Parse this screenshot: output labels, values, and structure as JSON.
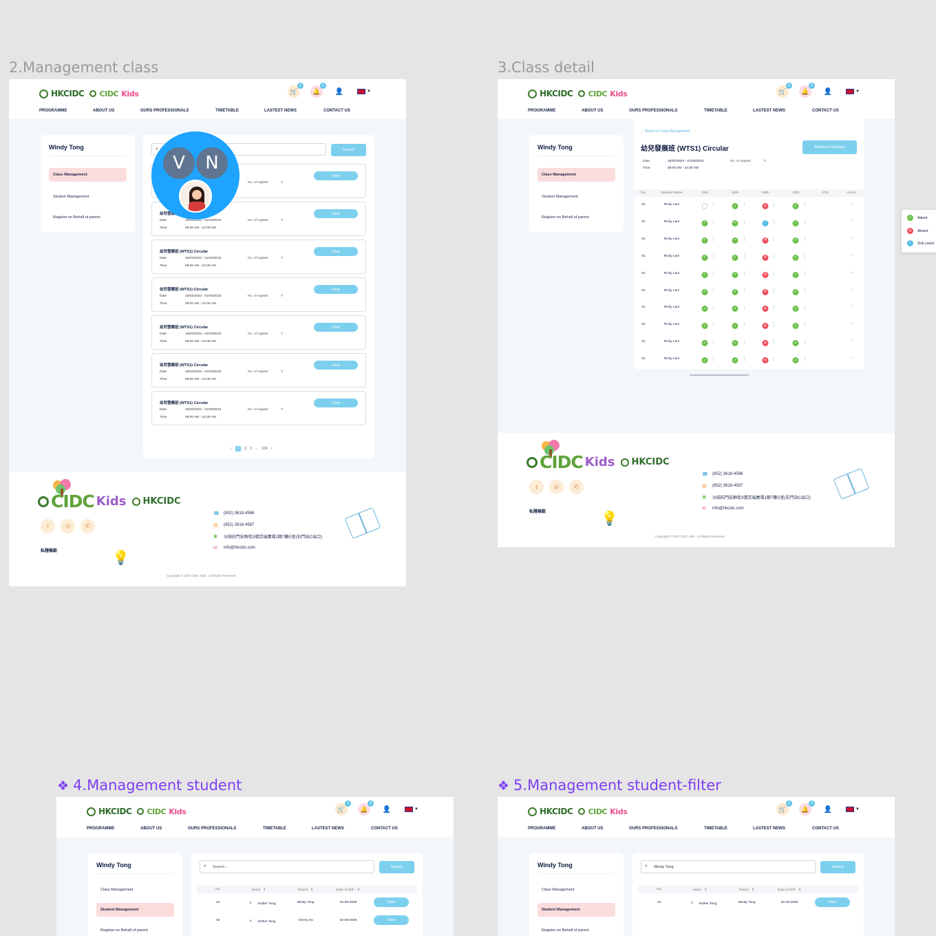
{
  "frames": {
    "f2": {
      "title": "2.Management class"
    },
    "f3": {
      "title": "3.Class detail"
    },
    "f4": {
      "title": "4.Management student"
    },
    "f5": {
      "title": "5.Management student-filter"
    }
  },
  "header": {
    "logo_hk": "HKCIDC",
    "logo_cidc": "CIDC",
    "logo_kids": "Kids",
    "cart_count": "0",
    "bell_count": "0",
    "nav": [
      "PROGRAMME",
      "ABOUT US",
      "OURS PROFESSIONALS",
      "TIMETABLE",
      "LASTEST NEWS",
      "CONTACT US"
    ]
  },
  "sidebar": {
    "user": "Windy Tong",
    "items": [
      "Class Management",
      "Student Management",
      "Register on Behalf of parent"
    ]
  },
  "class_list": {
    "search_button": "Search",
    "cards": [
      {
        "title": "幼兒發展班 (WTS1) Circular",
        "date_label": "Date",
        "date": "15/02/2023 - 01/03/2023",
        "time_label": "Time",
        "time": "08:00 AM - 10:30 AM",
        "reg_label": "No. of register",
        "reg": "7",
        "button": "View"
      }
    ],
    "pager": [
      "‹",
      "1",
      "2",
      "3",
      "...",
      "100",
      "›"
    ]
  },
  "avatars": {
    "v": "V",
    "n": "N"
  },
  "class_detail": {
    "back": "← Return to Class Management",
    "title": "幼兒發展班 (WTS1) Circular",
    "broadcast": "Broadcast Message",
    "date_label": "Date",
    "date": "15/02/2023 - 01/03/2023",
    "time_label": "Time",
    "time": "08:00 AM - 10:30 AM",
    "reg_label": "No. of register",
    "reg": "7",
    "columns": [
      "No.",
      "Student Name",
      "23/8",
      "30/8",
      "06/9",
      "13/9",
      "27/9",
      "Action"
    ],
    "row_no": "01",
    "row_name": "Ricky Lam",
    "row_action": "...",
    "rows": [
      [
        "empty",
        "ok",
        "no",
        "ok"
      ],
      [
        "ok",
        "ok",
        "sick",
        "ok"
      ],
      [
        "ok",
        "ok",
        "no",
        "ok"
      ],
      [
        "ok",
        "ok",
        "no",
        "ok"
      ],
      [
        "ok",
        "ok",
        "no",
        "ok"
      ],
      [
        "ok",
        "ok",
        "no",
        "ok"
      ],
      [
        "ok",
        "ok",
        "no",
        "ok"
      ],
      [
        "ok",
        "ok",
        "no",
        "ok"
      ],
      [
        "ok",
        "ok",
        "no",
        "ok"
      ],
      [
        "ok",
        "ok",
        "no",
        "ok"
      ]
    ]
  },
  "legend": [
    "Attend",
    "Absent",
    "Sick Leave"
  ],
  "student_mgmt": {
    "search_placeholder": "Search...",
    "search_button": "Search",
    "columns": [
      "No.",
      "Name",
      "Parent",
      "Date of birth"
    ],
    "rows": [
      {
        "no": "01",
        "name": "Esther Tong",
        "parent": "Windy Tong",
        "dob": "02-09-2009",
        "button": "View"
      },
      {
        "no": "02",
        "name": "Esther Tong",
        "parent": "Cherry Ho",
        "dob": "02-09-2009",
        "button": "View"
      }
    ]
  },
  "student_filter": {
    "search_value": "Windy Tong",
    "rows": [
      {
        "no": "01",
        "name": "Esther Tong",
        "parent": "Windy Tong",
        "dob": "02-09-2009",
        "button": "View"
      }
    ]
  },
  "footer": {
    "phone": "(852) 3618-4586",
    "fax": "(852) 3618-4587",
    "address": "沙田石門安群街3號京瑞廣場1期7樓G室(石門站C出口)",
    "email": "info@hkcidc.com",
    "privacy": "私隱條款",
    "copyright": "Copyright © 2020 CIDC Kids . All Rights Reserved."
  },
  "colors": {
    "accent": "#7dcfee",
    "active_item": "#fbdcdc",
    "component_title": "#7e3ff2",
    "avatar_ring": "#1ea3ff"
  }
}
